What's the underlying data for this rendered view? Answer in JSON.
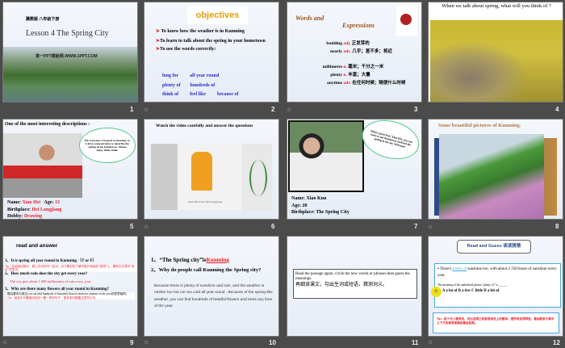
{
  "slides": [
    {
      "num": "1",
      "publisher": "冀教版 八年级下册",
      "title": "Lesson 4 The Spring City",
      "watermark": "第一PPT模板网-WWW.1PPT.COM"
    },
    {
      "num": "2",
      "heading": "objectives",
      "points": [
        "To know how the weather is in Kunming",
        "To learn to talk about the spring in your hometown",
        "To use the words correctly:"
      ],
      "phrases": [
        "long for",
        "all year round",
        "plenty of",
        "hundreds of",
        "think of",
        "feel like",
        "because of"
      ]
    },
    {
      "num": "3",
      "heading1": "Words and",
      "heading2": "Expressions",
      "words": [
        {
          "w": "budding",
          "pos": "adj.",
          "def": "正发芽的"
        },
        {
          "w": "nearly",
          "pos": "adv.",
          "def": "几乎；差不多；将近"
        },
        {
          "w": "millimetre",
          "pos": "n.",
          "def": "毫米；千分之一米"
        },
        {
          "w": "plenty",
          "pos": "n.",
          "def": "丰富；大量"
        },
        {
          "w": "anytime",
          "pos": "adv.",
          "def": "在任何时候；随便什么时候"
        }
      ]
    },
    {
      "num": "4",
      "title": "When we talk about spring, what will you think of ?"
    },
    {
      "num": "5",
      "title": "One of the most interesting descriptions :",
      "bubble": "Hi, everyone. I'm good at drawing, so I drew some pictures to describe the spring in my hometown . Please enjoy them, haha.",
      "name_label": "Name:",
      "name": "Xiao Hei",
      "age_label": "Age:",
      "age": "15",
      "birth_label": "Birthplace:",
      "birth": "Hei Longjiang",
      "hobby_label": "Hobby:",
      "hobby": "Drawing"
    },
    {
      "num": "6",
      "title": "Watch the video carefully and answer the questions",
      "caption": "Xiao Hei From Hei Longjiang"
    },
    {
      "num": "7",
      "bubble": "What a poor boy! Xiao Hei, you can come to my hometown and feel the spring in the air. Welcome!",
      "name": "Name: Xiao Kun",
      "age": "Age:   20",
      "birth": "Birthplace: The Spring City"
    },
    {
      "num": "8",
      "title": "Some beautiful pictures of Kunming."
    },
    {
      "num": "9",
      "title": "read and answer",
      "q1": "1、It is spring all year round in Kunming.（T or F）",
      "tip1": "Tip：在阅读过程中，看上去对的不一定对。对于题目的了解不能只停留在“感觉”上，要有去文章中“求证”的意识。",
      "q2": "2、How much rain does the city get every year?",
      "a2": "The city gets about 1 000 millimeters of rain every year.",
      "q3": "3、Why are there many flowers all year round in Kunming?",
      "a3": "题目要求与原文you can find hundreds of beautiful flowers and trees anytime of the year的意思相同。",
      "tip3": "Tip：阅读中不要害怕找到一模一样的句子，更多的时候要注意同义句。"
    },
    {
      "num": "10",
      "q1a": "1、“The Spring city”is",
      "q1b": "Kunming",
      "q2": "2、Why do people call Kunming the Spring city?",
      "ans": "Because there is plenty of sunshine and rain, and the weather is neither too hot nor too cold all year round . Because of the spring-like weather, you can find hundreds of beatiful flowers and trees any time of the year."
    },
    {
      "num": "11",
      "en": "Read the passage again, circle the new words or phrases then guess the meanings.",
      "zh": "再细读课文，勾出生词或短语，猜测词义。"
    },
    {
      "num": "12",
      "title": "Read and Guess  读读猜猜",
      "s1": "There's ",
      "s2": "plenty of",
      "s3": " sunshine too, with about 2 250 hours of sunshine every year.",
      "q": "The meaning of the underlined phrase “plenty of” is ______",
      "opts": "A a lot of      B a few     C little   D a bit of",
      "tip": "Tip：逐个代入替换法，对比选项之间意思用法上的差异，把所有选项带进，最后联系文章中上下文的意思来确定最后答案。"
    }
  ]
}
